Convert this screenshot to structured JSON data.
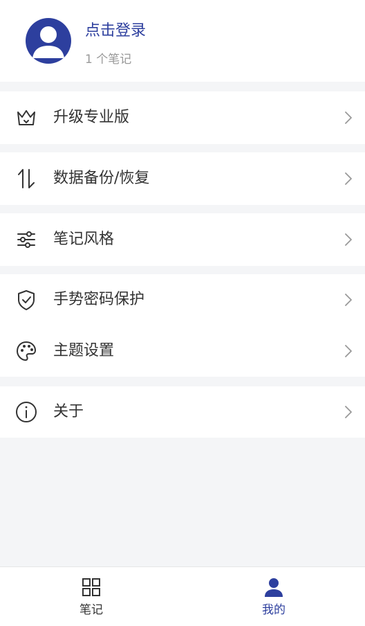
{
  "profile": {
    "login_title": "点击登录",
    "note_count": "1 个笔记"
  },
  "menu": {
    "upgrade": "升级专业版",
    "backup": "数据备份/恢复",
    "note_style": "笔记风格",
    "gesture_lock": "手势密码保护",
    "theme": "主题设置",
    "about": "关于"
  },
  "tabs": {
    "notes": "笔记",
    "mine": "我的"
  },
  "colors": {
    "accent": "#2d3f9e",
    "text": "#333333",
    "muted": "#999999",
    "background": "#f4f5f7"
  }
}
